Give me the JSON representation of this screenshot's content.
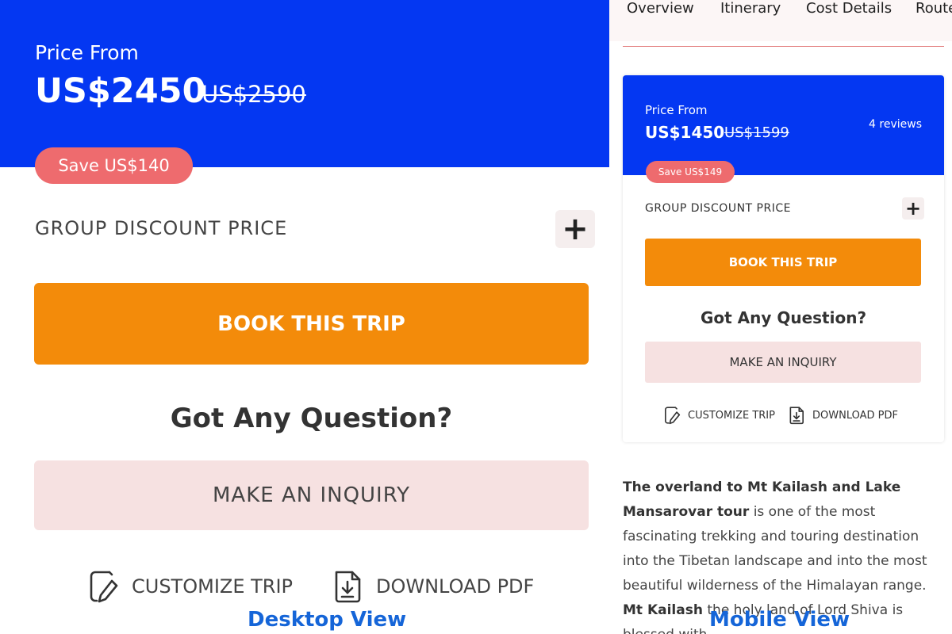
{
  "desktop": {
    "price_label": "Price From",
    "price": "US$2450",
    "old_price": "US$2590",
    "save": "Save US$140",
    "group_discount": "GROUP DISCOUNT PRICE",
    "plus": "+",
    "book": "BOOK THIS TRIP",
    "question": "Got Any Question?",
    "inquiry": "MAKE AN INQUIRY",
    "customize": "CUSTOMIZE TRIP",
    "download": "DOWNLOAD PDF",
    "caption": "Desktop View"
  },
  "mobile": {
    "tabs": [
      "Overview",
      "Itinerary",
      "Cost Details",
      "Route"
    ],
    "price_label": "Price From",
    "price": "US$1450",
    "old_price": "US$1599",
    "reviews": "4 reviews",
    "save": "Save US$149",
    "group_discount": "GROUP DISCOUNT PRICE",
    "plus": "+",
    "book": "BOOK THIS TRIP",
    "question": "Got Any Question?",
    "inquiry": "MAKE AN INQUIRY",
    "customize": "CUSTOMIZE TRIP",
    "download": "DOWNLOAD PDF",
    "description": {
      "bold1": "The overland to Mt Kailash and Lake Mansarovar tour",
      "text1": " is one of the most fascinating trekking and touring destination into the Tibetan landscape and into the most beautiful wilderness of the Himalayan range. ",
      "bold2": "Mt Kailash",
      "text2": " the holy land of Lord Shiva is blessed with"
    },
    "caption": "Mobile View"
  },
  "colors": {
    "hero_blue": "#0437f2",
    "book_orange": "#f38b0a",
    "save_red": "#ee6b6e",
    "inquiry_pink": "#f6e1e1",
    "caption_blue": "#1565d8"
  },
  "icons": [
    "edit-document-icon",
    "download-document-icon",
    "plus-icon"
  ]
}
